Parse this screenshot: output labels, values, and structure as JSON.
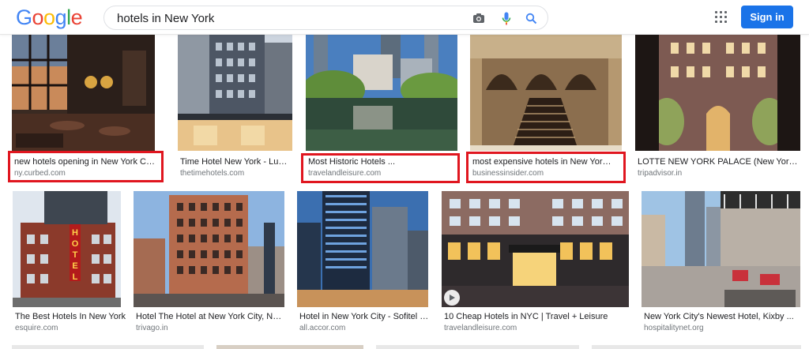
{
  "header": {
    "logo_letters": [
      {
        "ch": "G",
        "color": "#4285F4"
      },
      {
        "ch": "o",
        "color": "#EA4335"
      },
      {
        "ch": "o",
        "color": "#FBBC05"
      },
      {
        "ch": "g",
        "color": "#4285F4"
      },
      {
        "ch": "l",
        "color": "#34A853"
      },
      {
        "ch": "e",
        "color": "#EA4335"
      }
    ],
    "search_query": "hotels in New York",
    "camera_icon": "camera-icon",
    "mic_icon": "microphone-icon",
    "search_icon": "search-icon",
    "apps_icon": "apps-grid-icon",
    "signin_label": "Sign in"
  },
  "results_row1": [
    {
      "title": "new hotels opening in New York City ...",
      "source": "ny.curbed.com",
      "highlighted": true
    },
    {
      "title": "Time Hotel New York - Luxury ...",
      "source": "thetimehotels.com",
      "highlighted": false
    },
    {
      "title": "Most Historic Hotels ...",
      "source": "travelandleisure.com",
      "highlighted": true
    },
    {
      "title": "most expensive hotels in New York ...",
      "source": "businessinsider.com",
      "highlighted": true
    },
    {
      "title": "LOTTE NEW YORK PALACE (New York City ...",
      "source": "tripadvisor.in",
      "highlighted": false
    }
  ],
  "results_row2": [
    {
      "title": "The Best Hotels In New York",
      "source": "esquire.com",
      "sign_text": "HOTEL"
    },
    {
      "title": "Hotel The Hotel at New York City, New ...",
      "source": "trivago.in"
    },
    {
      "title": "Hotel in New York City - Sofitel New ...",
      "source": "all.accor.com"
    },
    {
      "title": "10 Cheap Hotels in NYC | Travel + Leisure",
      "source": "travelandleisure.com",
      "has_video": true
    },
    {
      "title": "New York City's Newest Hotel, Kixby ...",
      "source": "hospitalitynet.org"
    }
  ],
  "colors": {
    "highlight": "#e0161f",
    "signin_bg": "#1a73e8",
    "google_blue": "#4285F4",
    "google_red": "#EA4335",
    "google_yellow": "#FBBC05",
    "google_green": "#34A853"
  }
}
